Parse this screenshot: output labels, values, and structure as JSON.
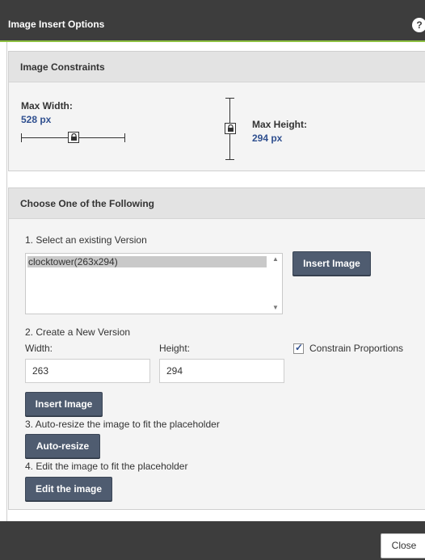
{
  "dialog": {
    "title": "Image Insert Options",
    "help_label": "?"
  },
  "constraints": {
    "header": "Image Constraints",
    "max_width_label": "Max Width:",
    "max_width_value": "528 px",
    "max_height_label": "Max Height:",
    "max_height_value": "294 px"
  },
  "choose": {
    "header": "Choose One of the Following",
    "step1_label": "1. Select an existing Version",
    "versions": [
      "clocktower(263x294)"
    ],
    "insert_image_button_1": "Insert Image",
    "step2_label": "2. Create a New Version",
    "width_label": "Width:",
    "height_label": "Height:",
    "width_value": "263",
    "height_value": "294",
    "constrain_label": "Constrain Proportions",
    "constrain_checked": true,
    "insert_image_button_2": "Insert Image",
    "step3_label": "3. Auto-resize the image to fit the placeholder",
    "auto_resize_button": "Auto-resize",
    "step4_label": "4. Edit the image to fit the placeholder",
    "edit_button": "Edit the image"
  },
  "footer": {
    "close_button": "Close"
  },
  "colors": {
    "titlebar": "#3d3d3d",
    "accent_line": "#8cbf3f",
    "button": "#4f5c70",
    "value_blue": "#2f4f8f"
  }
}
